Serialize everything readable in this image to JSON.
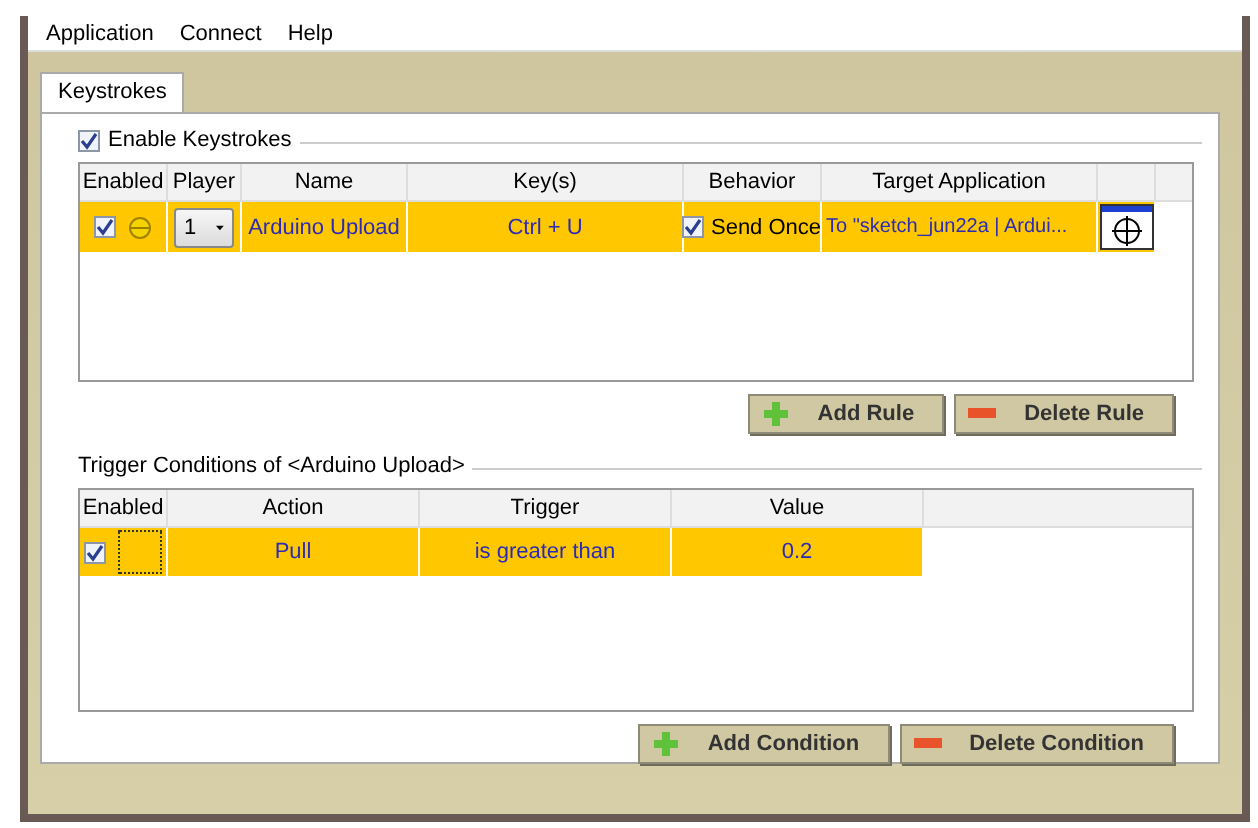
{
  "menu": [
    "Application",
    "Connect",
    "Help"
  ],
  "tabs": [
    {
      "label": "Keystrokes",
      "selected": true
    }
  ],
  "enable_keystrokes": {
    "label": "Enable Keystrokes",
    "checked": true
  },
  "rules": {
    "columns": [
      "Enabled",
      "Player",
      "Name",
      "Key(s)",
      "Behavior",
      "Target Application"
    ],
    "rows": [
      {
        "enabled": true,
        "player": "1",
        "name": "Arduino Upload",
        "keys": "Ctrl + U",
        "behavior_checked": true,
        "behavior": "Send Once",
        "target": "To \"sketch_jun22a | Ardui...",
        "selected": true
      }
    ]
  },
  "rule_buttons": [
    {
      "kind": "add",
      "label": "Add Rule"
    },
    {
      "kind": "delete",
      "label": "Delete Rule"
    }
  ],
  "conditions_title": "Trigger Conditions of <Arduino Upload>",
  "conditions": {
    "columns": [
      "Enabled",
      "Action",
      "Trigger",
      "Value"
    ],
    "rows": [
      {
        "enabled": true,
        "action": "Pull",
        "trigger": "is greater than",
        "value": "0.2",
        "selected": true
      }
    ]
  },
  "condition_buttons": [
    {
      "kind": "add",
      "label": "Add Condition"
    },
    {
      "kind": "delete",
      "label": "Delete Condition"
    }
  ]
}
